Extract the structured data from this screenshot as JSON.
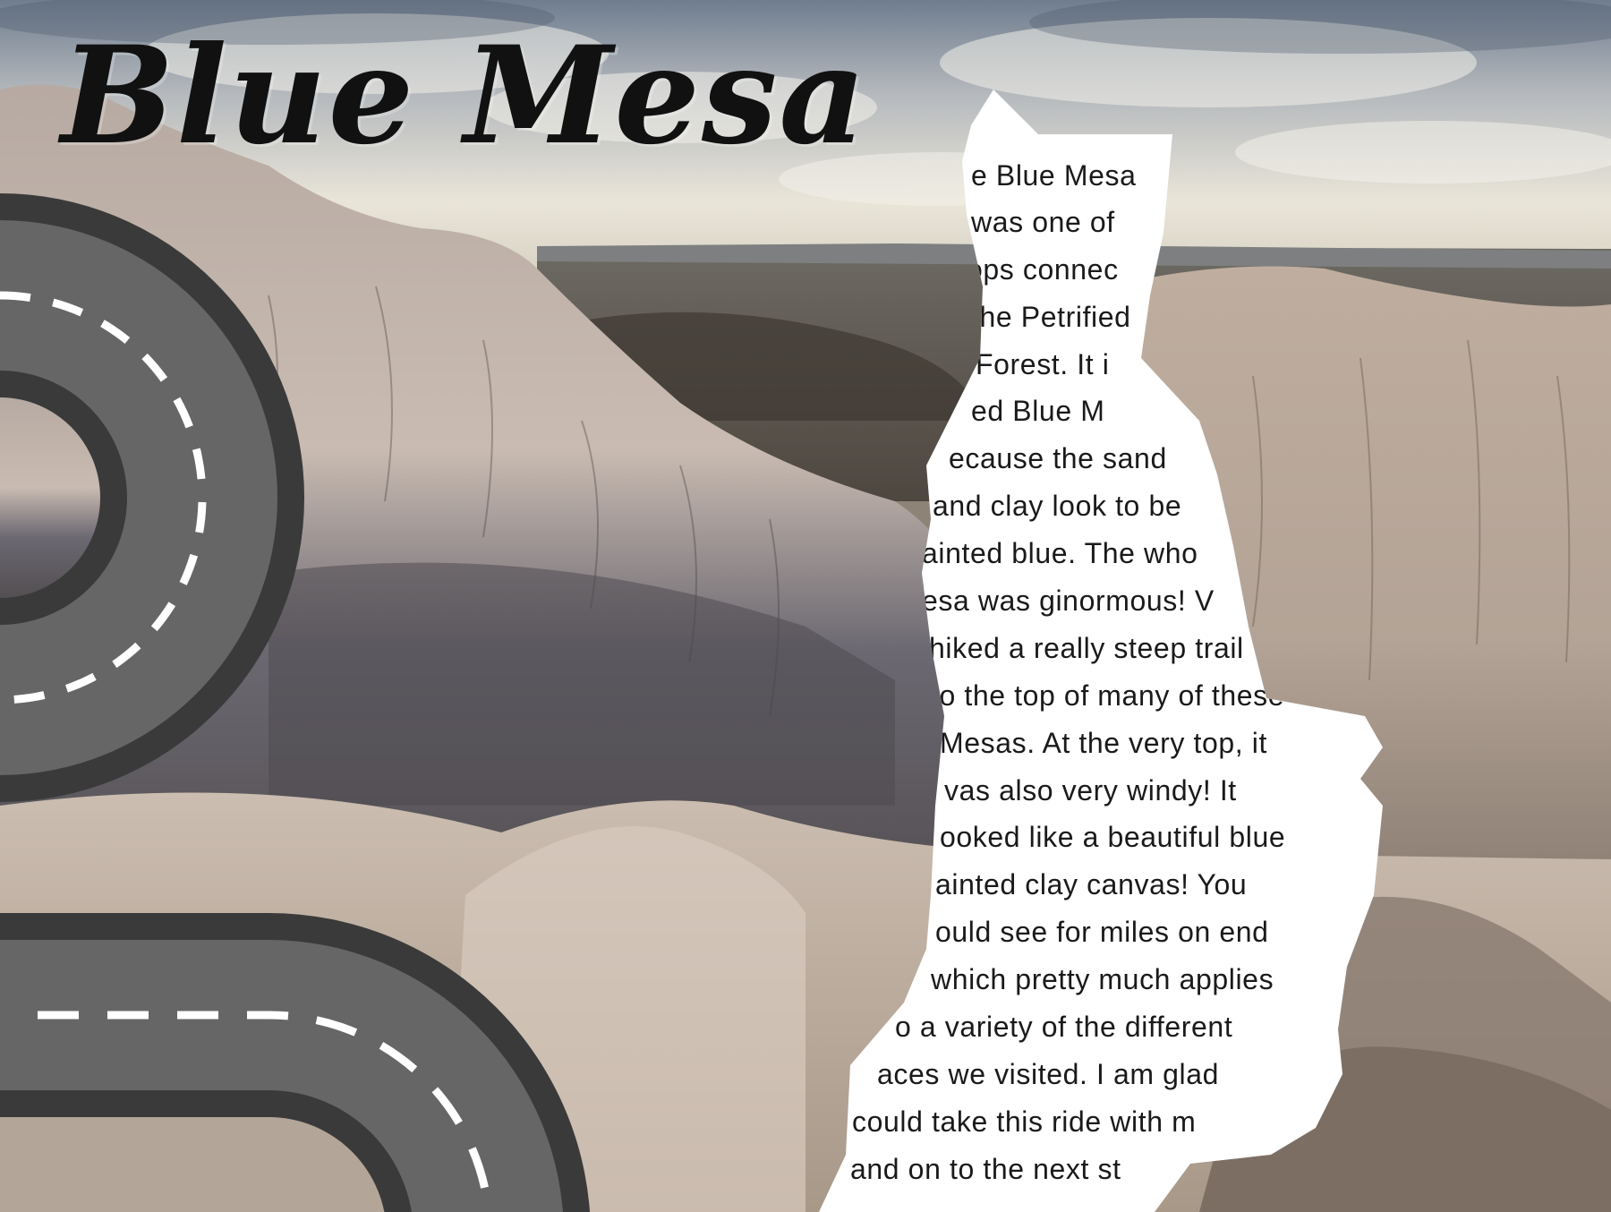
{
  "page": {
    "title": "Blue Mesa",
    "story_lines": [
      "e Blue Mesa",
      "was one of",
      "ops connec",
      "the Petrified",
      "Forest. It i",
      "ed Blue M",
      "ecause the sand",
      "and clay look to be",
      "ainted blue. The who",
      "esa was ginormous! V",
      "hiked a really steep trail",
      "to the top of many of these",
      "Mesas. At the very top, it",
      "vas also very windy! It",
      "ooked like a beautiful blue",
      "ainted clay canvas! You",
      "ould see for miles on end",
      "which pretty much applies",
      "o a variety of the different",
      "aces we visited. I am glad",
      "could take this ride with m",
      "and on to the next st"
    ]
  },
  "colors": {
    "sky_top": "#7d8a9a",
    "sky_light": "#e8e6dd",
    "mesa_light": "#cdbfb6",
    "mesa_dark": "#5e5a5e",
    "road": "#666666",
    "road_edge": "#3a3a3a",
    "road_dash": "#ffffff",
    "paper": "#ffffff"
  }
}
